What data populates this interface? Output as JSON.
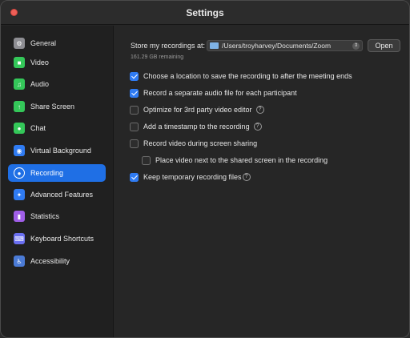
{
  "window": {
    "title": "Settings"
  },
  "sidebar": {
    "items": [
      {
        "label": "General",
        "icon": "gear-icon",
        "color": "#8e8e93",
        "glyph": "⚙"
      },
      {
        "label": "Video",
        "icon": "video-camera-icon",
        "color": "#34c759",
        "glyph": "■"
      },
      {
        "label": "Audio",
        "icon": "headphones-icon",
        "color": "#34c759",
        "glyph": "♫"
      },
      {
        "label": "Share Screen",
        "icon": "share-screen-icon",
        "color": "#34c759",
        "glyph": "↑"
      },
      {
        "label": "Chat",
        "icon": "chat-bubble-icon",
        "color": "#34c759",
        "glyph": "●"
      },
      {
        "label": "Virtual Background",
        "icon": "person-background-icon",
        "color": "#2f7bf2",
        "glyph": "◉"
      },
      {
        "label": "Recording",
        "icon": "record-icon",
        "color": "#1f6fe5",
        "glyph": "◎",
        "active": true
      },
      {
        "label": "Advanced Features",
        "icon": "sparkle-icon",
        "color": "#2f7bf2",
        "glyph": "✦"
      },
      {
        "label": "Statistics",
        "icon": "bar-chart-icon",
        "color": "#a05ee8",
        "glyph": "▮"
      },
      {
        "label": "Keyboard Shortcuts",
        "icon": "keyboard-icon",
        "color": "#6a6ff0",
        "glyph": "⌨"
      },
      {
        "label": "Accessibility",
        "icon": "accessibility-icon",
        "color": "#4b7bd6",
        "glyph": "♿"
      }
    ]
  },
  "main": {
    "store_label": "Store my recordings at:",
    "path_value": "/Users/troyharvey/Documents/Zoom",
    "open_label": "Open",
    "remaining": "161.29 GB remaining",
    "options": [
      {
        "label": "Choose a location to save the recording to after the meeting ends",
        "checked": true,
        "help": false
      },
      {
        "label": "Record a separate audio file for each participant",
        "checked": true,
        "help": false
      },
      {
        "label": "Optimize for 3rd party video editor",
        "checked": false,
        "help": true
      },
      {
        "label": "Add a timestamp to the recording",
        "checked": false,
        "help": true
      },
      {
        "label": "Record video during screen sharing",
        "checked": false,
        "help": false
      },
      {
        "label": "Place video next to the shared screen in the recording",
        "checked": false,
        "help": false,
        "indent": true
      },
      {
        "label": "Keep temporary recording files",
        "checked": true,
        "help": true
      }
    ]
  },
  "colors": {
    "accent": "#1f6fe5",
    "checkbox_blue": "#2f7bf2"
  }
}
